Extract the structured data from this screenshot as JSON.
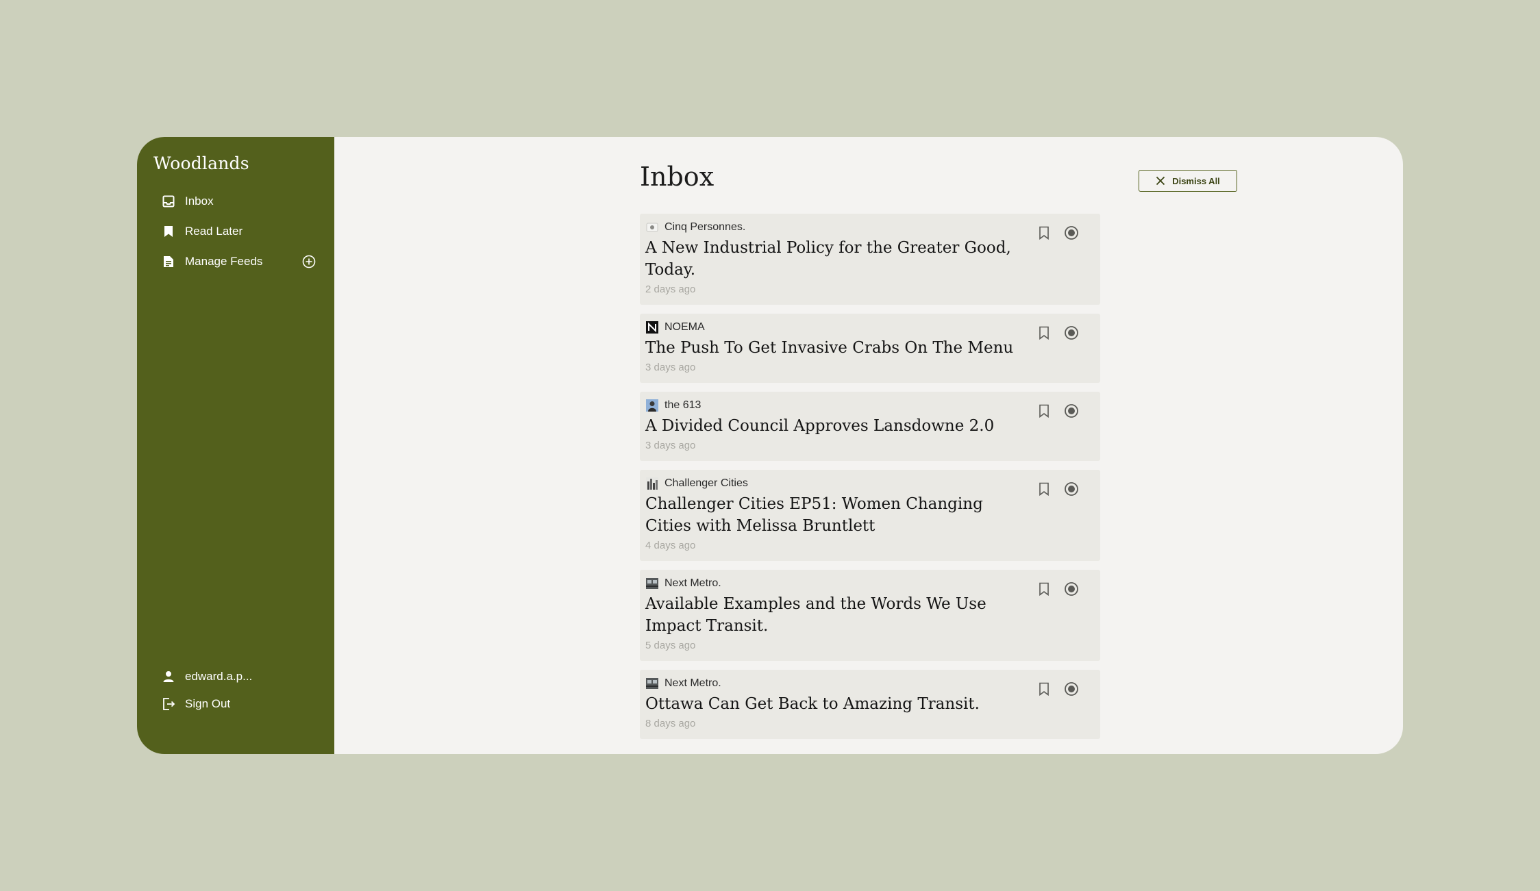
{
  "colors": {
    "background": "#ccd0bc",
    "sidebar": "#53601c",
    "panel": "#f4f3f1",
    "card": "#eae9e4",
    "muted_text": "#a9a8a2"
  },
  "sidebar": {
    "brand": "Woodlands",
    "items": [
      {
        "label": "Inbox",
        "icon": "inbox-icon"
      },
      {
        "label": "Read Later",
        "icon": "bookmark-icon"
      },
      {
        "label": "Manage Feeds",
        "icon": "document-icon",
        "action_icon": "plus-circle-icon"
      }
    ],
    "user": {
      "label": "edward.a.p...",
      "icon": "user-icon"
    },
    "sign_out": {
      "label": "Sign Out",
      "icon": "sign-out-icon"
    }
  },
  "header": {
    "title": "Inbox",
    "dismiss_all_label": "Dismiss All",
    "dismiss_icon": "close-icon"
  },
  "feed": [
    {
      "source": "Cinq Personnes.",
      "favicon": "cinq-personnes-favicon",
      "title": "A New Industrial Policy for the Greater Good, Today.",
      "time": "2 days ago"
    },
    {
      "source": "NOEMA",
      "favicon": "noema-favicon",
      "title": "The Push To Get Invasive Crabs On The Menu",
      "time": "3 days ago"
    },
    {
      "source": "the 613",
      "favicon": "the-613-favicon",
      "title": "A Divided Council Approves Lansdowne 2.0",
      "time": "3 days ago"
    },
    {
      "source": "Challenger Cities",
      "favicon": "challenger-cities-favicon",
      "title": "Challenger Cities EP51: Women Changing Cities with Melissa Bruntlett",
      "time": "4 days ago"
    },
    {
      "source": "Next Metro.",
      "favicon": "next-metro-favicon",
      "title": "Available Examples and the Words We Use Impact Transit.",
      "time": "5 days ago"
    },
    {
      "source": "Next Metro.",
      "favicon": "next-metro-favicon",
      "title": "Ottawa Can Get Back to Amazing Transit.",
      "time": "8 days ago"
    }
  ]
}
